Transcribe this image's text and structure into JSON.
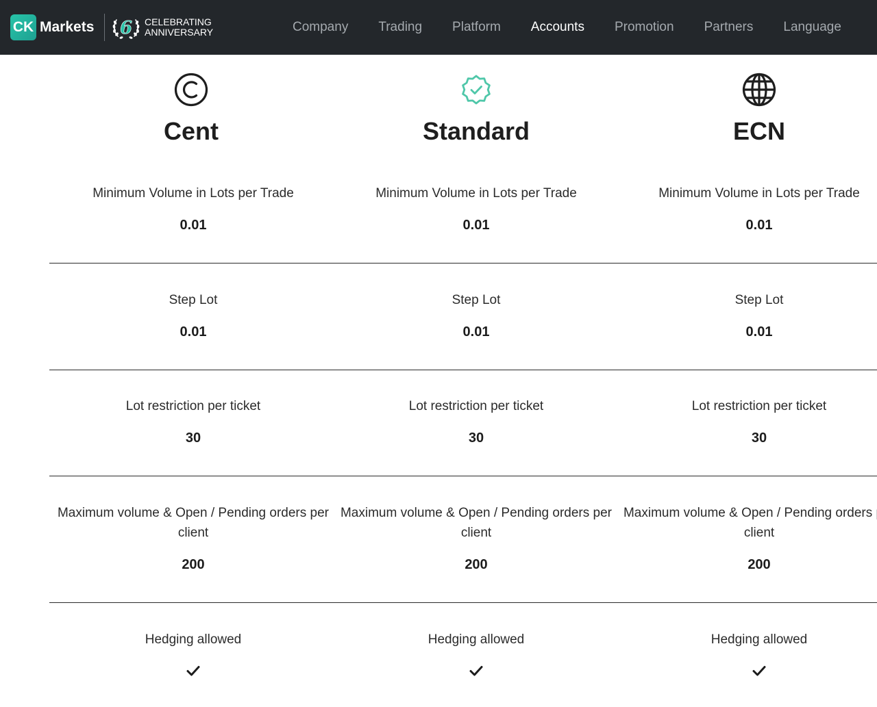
{
  "brand": {
    "badge": "CK",
    "name": "Markets",
    "anniversary_number": "6",
    "anniversary_line1": "CELEBRATING",
    "anniversary_line2": "ANNIVERSARY"
  },
  "nav": {
    "items": [
      {
        "label": "Company",
        "active": false
      },
      {
        "label": "Trading",
        "active": false
      },
      {
        "label": "Platform",
        "active": false
      },
      {
        "label": "Accounts",
        "active": true
      },
      {
        "label": "Promotion",
        "active": false
      },
      {
        "label": "Partners",
        "active": false
      },
      {
        "label": "Language",
        "active": false
      }
    ]
  },
  "plans": [
    {
      "name": "Cent",
      "icon": "copyright-circle-icon"
    },
    {
      "name": "Standard",
      "icon": "verified-badge-icon",
      "icon_color": "#4fc7a9"
    },
    {
      "name": "ECN",
      "icon": "globe-icon"
    }
  ],
  "rows": [
    {
      "labels": [
        "Minimum Volume in Lots per Trade",
        "Minimum Volume in Lots per Trade",
        "Minimum Volume in Lots per Trade"
      ],
      "values": [
        "0.01",
        "0.01",
        "0.01"
      ]
    },
    {
      "labels": [
        "Step Lot",
        "Step Lot",
        "Step Lot"
      ],
      "values": [
        "0.01",
        "0.01",
        "0.01"
      ]
    },
    {
      "labels": [
        "Lot restriction per ticket",
        "Lot restriction per ticket",
        "Lot restriction per ticket"
      ],
      "values": [
        "30",
        "30",
        "30"
      ]
    },
    {
      "labels": [
        "Maximum volume & Open / Pending orders per client",
        "Maximum volume & Open / Pending orders per client",
        "Maximum volume & Open / Pending orders per client"
      ],
      "values": [
        "200",
        "200",
        "200"
      ]
    },
    {
      "labels": [
        "Hedging allowed",
        "Hedging allowed",
        "Hedging allowed"
      ],
      "values": [
        "check-icon",
        "check-icon",
        "check-icon"
      ]
    }
  ],
  "colors": {
    "header_bg": "#23272b",
    "brand_accent": "#27c3a8",
    "nav_inactive": "#a4a9ae",
    "nav_active": "#ffffff"
  }
}
